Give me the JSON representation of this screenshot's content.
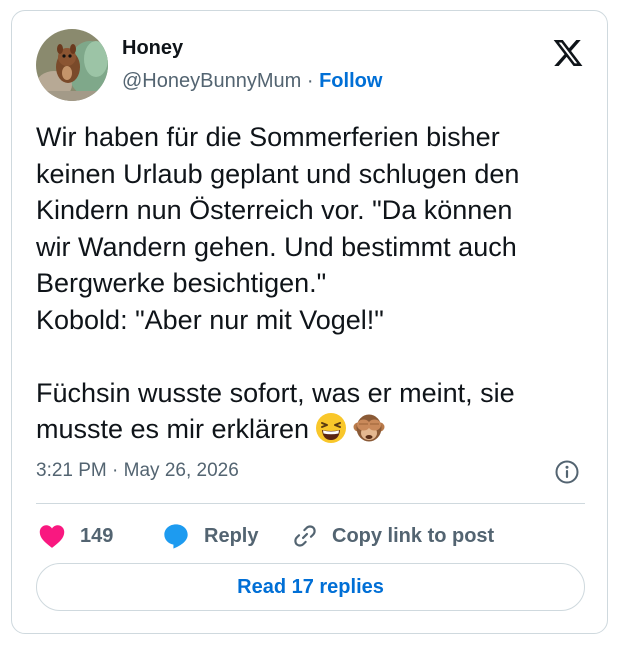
{
  "author": {
    "name": "Honey",
    "handle": "@HoneyBunnyMum",
    "separator": "·",
    "follow_label": "Follow",
    "avatar_icon": "squirrel-avatar"
  },
  "platform_icon": "x-logo-icon",
  "tweet": {
    "lines": [
      "Wir haben für die Sommerferien bisher",
      "keinen Urlaub geplant und schlugen den",
      "Kindern nun Österreich vor. \"Da können",
      "wir Wandern gehen. Und bestimmt auch",
      "Bergwerke besichtigen.\"",
      "Kobold: \"Aber nur mit Vogel!\"",
      "",
      "Füchsin wusste sofort, was er meint, sie",
      "musste es mir erklären"
    ],
    "emojis": [
      "grinning-squinting-face-emoji",
      "see-no-evil-monkey-emoji"
    ]
  },
  "timestamp": {
    "time": "3:21 PM",
    "separator": "·",
    "date": "May 26, 2026"
  },
  "actions": {
    "like_count": "149",
    "reply_label": "Reply",
    "copy_label": "Copy link to post"
  },
  "read_replies_label": "Read 17 replies",
  "colors": {
    "link_blue": "#006fd6",
    "like_pink": "#f91880",
    "reply_blue": "#1d9bf0",
    "muted_text": "#536471",
    "border": "#cfd9de"
  }
}
